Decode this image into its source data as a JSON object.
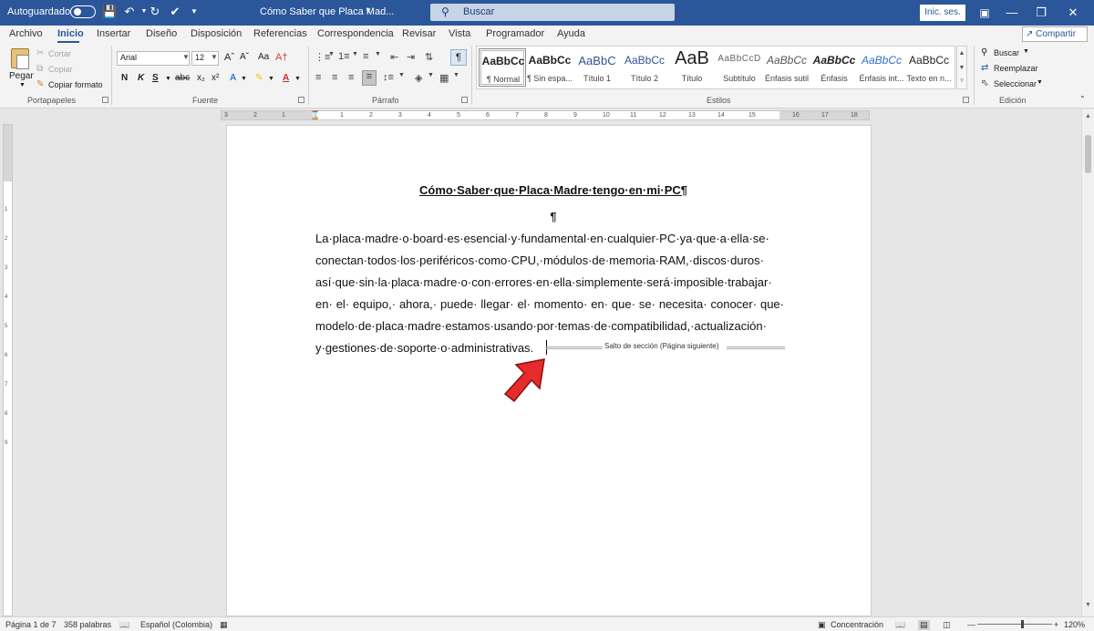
{
  "titlebar": {
    "autosave_label": "Autoguardado",
    "document_title": "Cómo Saber que Placa Mad...",
    "search_placeholder": "Buscar",
    "signin_label": "Inic. ses."
  },
  "tabs": [
    "Archivo",
    "Inicio",
    "Insertar",
    "Diseño",
    "Disposición",
    "Referencias",
    "Correspondencia",
    "Revisar",
    "Vista",
    "Programador",
    "Ayuda"
  ],
  "active_tab": "Inicio",
  "share_label": "Compartir",
  "ribbon": {
    "clipboard": {
      "label": "Portapapeles",
      "paste": "Pegar",
      "cut": "Cortar",
      "copy": "Copiar",
      "format_painter": "Copiar formato"
    },
    "font": {
      "label": "Fuente",
      "font_name": "Arial",
      "font_size": "12"
    },
    "paragraph": {
      "label": "Párrafo"
    },
    "styles": {
      "label": "Estilos",
      "items": [
        {
          "sample": "AaBbCc",
          "name": "¶ Normal"
        },
        {
          "sample": "AaBbCc",
          "name": "¶ Sin espa..."
        },
        {
          "sample": "AaBbC",
          "name": "Título 1"
        },
        {
          "sample": "AaBbCc",
          "name": "Título 2"
        },
        {
          "sample": "AaB",
          "name": "Título"
        },
        {
          "sample": "AaBbCcD",
          "name": "Subtítulo"
        },
        {
          "sample": "AaBbCc",
          "name": "Énfasis sutil"
        },
        {
          "sample": "AaBbCc",
          "name": "Énfasis"
        },
        {
          "sample": "AaBbCc",
          "name": "Énfasis int..."
        },
        {
          "sample": "AaBbCc",
          "name": "Texto en n..."
        }
      ]
    },
    "editing": {
      "label": "Edición",
      "find": "Buscar",
      "replace": "Reemplazar",
      "select": "Seleccionar"
    }
  },
  "document": {
    "heading": "Cómo·Saber·que·Placa·Madre·tengo·en·mi·PC¶",
    "pilcrow": "¶",
    "lines": [
      "La·placa·madre·o·board·es·esencial·y·fundamental·en·cualquier·PC·ya·que·a·ella·se·",
      "conectan·todos·los·periféricos·como·CPU,·módulos·de·memoria·RAM,·discos·duros·",
      "así·que·sin·la·placa·madre·o·con·errores·en·ella·simplemente·será·imposible·trabajar·",
      "en· el· equipo,· ahora,· puede· llegar· el· momento· en· que· se· necesita· conocer· que·",
      "modelo·de·placa·madre·estamos·usando·por·temas·de·compatibilidad,·actualización·",
      "y·gestiones·de·soporte·o·administrativas."
    ],
    "section_break": "Salto de sección (Página siguiente)"
  },
  "ruler": {
    "h_ticks": [
      "3",
      "2",
      "1",
      "1",
      "2",
      "3",
      "4",
      "5",
      "6",
      "7",
      "8",
      "9",
      "10",
      "11",
      "12",
      "13",
      "14",
      "15",
      "16",
      "17",
      "18"
    ],
    "v_ticks": [
      "1",
      "2",
      "3",
      "4",
      "5",
      "6",
      "7",
      "8",
      "9"
    ]
  },
  "status": {
    "page": "Página 1 de 7",
    "words": "358 palabras",
    "language": "Español (Colombia)",
    "focus": "Concentración",
    "zoom": "120%"
  },
  "colors": {
    "accent": "#2b579a",
    "arrow": "#e52b2b"
  }
}
